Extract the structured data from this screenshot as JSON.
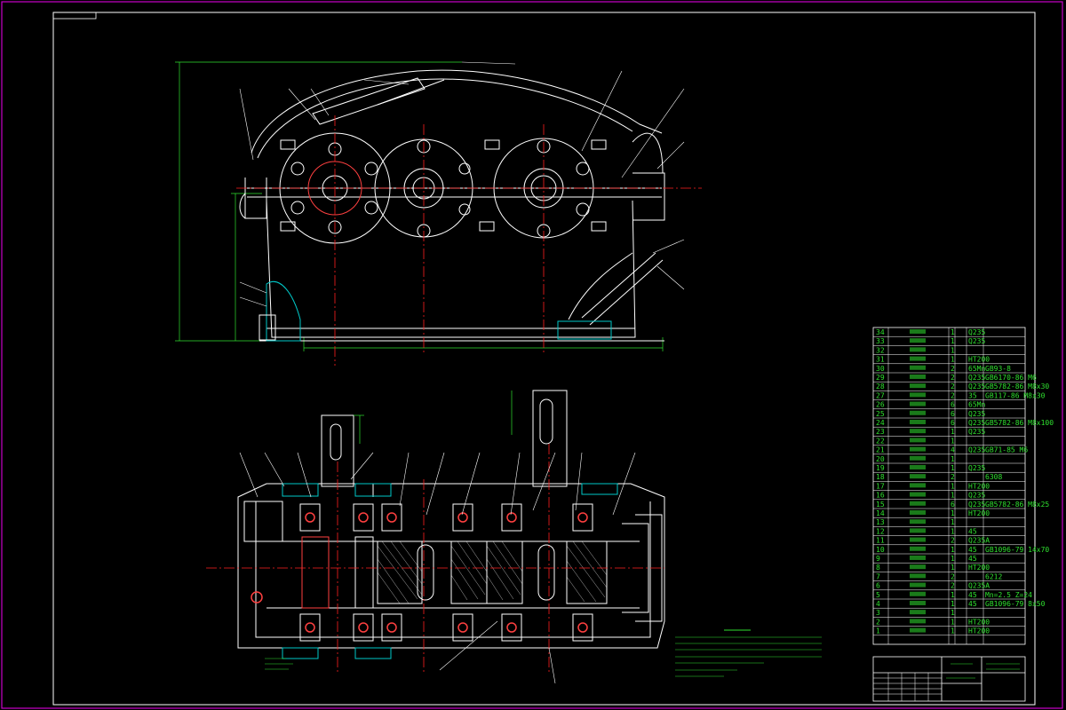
{
  "colors": {
    "background": "#000000",
    "frame": "#c800c8",
    "outline": "#ffffff",
    "centerline": "#ff2020",
    "dimension": "#2fe02f",
    "hatch": "#00c8c8",
    "bolt": "#ff4040"
  },
  "bom": {
    "rows": [
      {
        "no": "34",
        "material": "Q235",
        "count": "1",
        "note": ""
      },
      {
        "no": "33",
        "material": "Q235",
        "count": "1",
        "note": ""
      },
      {
        "no": "32",
        "material": "",
        "count": "1",
        "note": ""
      },
      {
        "no": "31",
        "material": "HT200",
        "count": "1",
        "note": ""
      },
      {
        "no": "30",
        "material": "65Mn",
        "count": "2",
        "note": "GB93-8"
      },
      {
        "no": "29",
        "material": "Q235",
        "count": "2",
        "note": "GB6170-86 M6"
      },
      {
        "no": "28",
        "material": "Q235",
        "count": "2",
        "note": "GB5782-86 M8x30"
      },
      {
        "no": "27",
        "material": "35",
        "count": "2",
        "note": "GB117-86 M8x30"
      },
      {
        "no": "26",
        "material": "65Mn",
        "count": "6",
        "note": ""
      },
      {
        "no": "25",
        "material": "Q235",
        "count": "6",
        "note": ""
      },
      {
        "no": "24",
        "material": "Q235",
        "count": "6",
        "note": "GB5782-86 M8x100"
      },
      {
        "no": "23",
        "material": "Q235",
        "count": "1",
        "note": ""
      },
      {
        "no": "22",
        "material": "",
        "count": "1",
        "note": ""
      },
      {
        "no": "21",
        "material": "Q235",
        "count": "4",
        "note": "GB71-85 M6"
      },
      {
        "no": "20",
        "material": "",
        "count": "1",
        "note": ""
      },
      {
        "no": "19",
        "material": "Q235",
        "count": "1",
        "note": ""
      },
      {
        "no": "18",
        "material": "",
        "count": "2",
        "note": "6308"
      },
      {
        "no": "17",
        "material": "HT200",
        "count": "1",
        "note": ""
      },
      {
        "no": "16",
        "material": "Q235",
        "count": "1",
        "note": ""
      },
      {
        "no": "15",
        "material": "Q235",
        "count": "6",
        "note": "GB5782-86 M8x25"
      },
      {
        "no": "14",
        "material": "HT200",
        "count": "1",
        "note": ""
      },
      {
        "no": "13",
        "material": "",
        "count": "1",
        "note": ""
      },
      {
        "no": "12",
        "material": "45",
        "count": "1",
        "note": ""
      },
      {
        "no": "11",
        "material": "Q235A",
        "count": "2",
        "note": ""
      },
      {
        "no": "10",
        "material": "45",
        "count": "1",
        "note": "GB1096-79 14x70"
      },
      {
        "no": "9",
        "material": "45",
        "count": "1",
        "note": ""
      },
      {
        "no": "8",
        "material": "HT200",
        "count": "1",
        "note": ""
      },
      {
        "no": "7",
        "material": "",
        "count": "2",
        "note": "6212"
      },
      {
        "no": "6",
        "material": "Q235A",
        "count": "2",
        "note": ""
      },
      {
        "no": "5",
        "material": "45",
        "count": "1",
        "note": "Mn=2.5 Z=24"
      },
      {
        "no": "4",
        "material": "45",
        "count": "1",
        "note": "GB1096-79 8x50"
      },
      {
        "no": "3",
        "material": "",
        "count": "1",
        "note": ""
      },
      {
        "no": "2",
        "material": "HT200",
        "count": "1",
        "note": ""
      },
      {
        "no": "1",
        "material": "HT200",
        "count": "1",
        "note": ""
      }
    ]
  }
}
